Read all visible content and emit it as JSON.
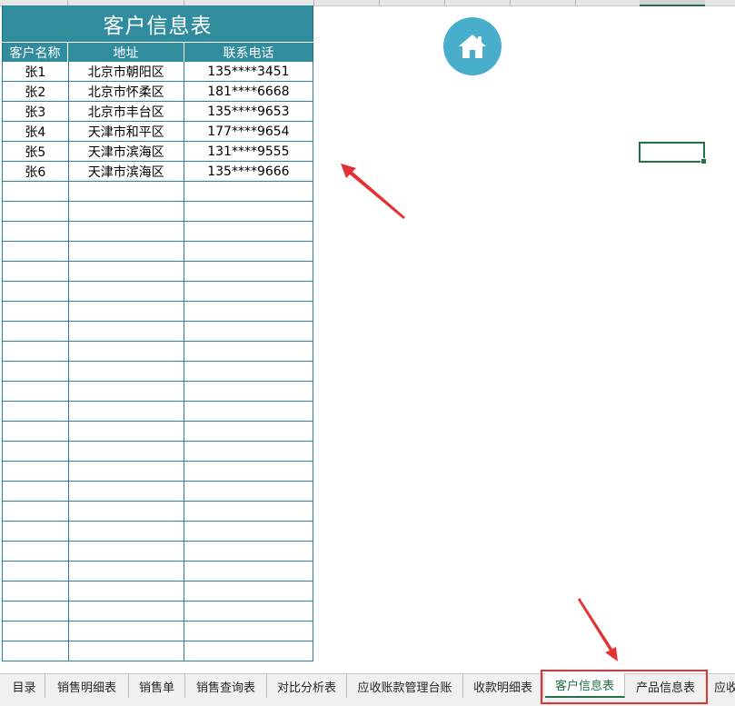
{
  "table": {
    "title": "客户信息表",
    "headers": [
      "客户名称",
      "地址",
      "联系电话"
    ],
    "rows": [
      [
        "张1",
        "北京市朝阳区",
        "135****3451"
      ],
      [
        "张2",
        "北京市怀柔区",
        "181****6668"
      ],
      [
        "张3",
        "北京市丰台区",
        "135****9653"
      ],
      [
        "张4",
        "天津市和平区",
        "177****9654"
      ],
      [
        "张5",
        "天津市滨海区",
        "131****9555"
      ],
      [
        "张6",
        "天津市滨海区",
        "135****9666"
      ]
    ],
    "empty_rows": 24
  },
  "home_button": {
    "icon": "home-icon",
    "color": "#48aecb"
  },
  "sheet_tabs": [
    {
      "label": "目录"
    },
    {
      "label": "销售明细表"
    },
    {
      "label": "销售单"
    },
    {
      "label": "销售查询表"
    },
    {
      "label": "对比分析表"
    },
    {
      "label": "应收账款管理台账"
    },
    {
      "label": "收款明细表"
    },
    {
      "label": "客户信息表",
      "active": true
    },
    {
      "label": "产品信息表"
    },
    {
      "label": "应收"
    }
  ],
  "colors": {
    "header_bg": "#318c9d",
    "grid_border": "#2c7fa0",
    "annotation_red": "#e23232",
    "excel_green": "#217346"
  }
}
